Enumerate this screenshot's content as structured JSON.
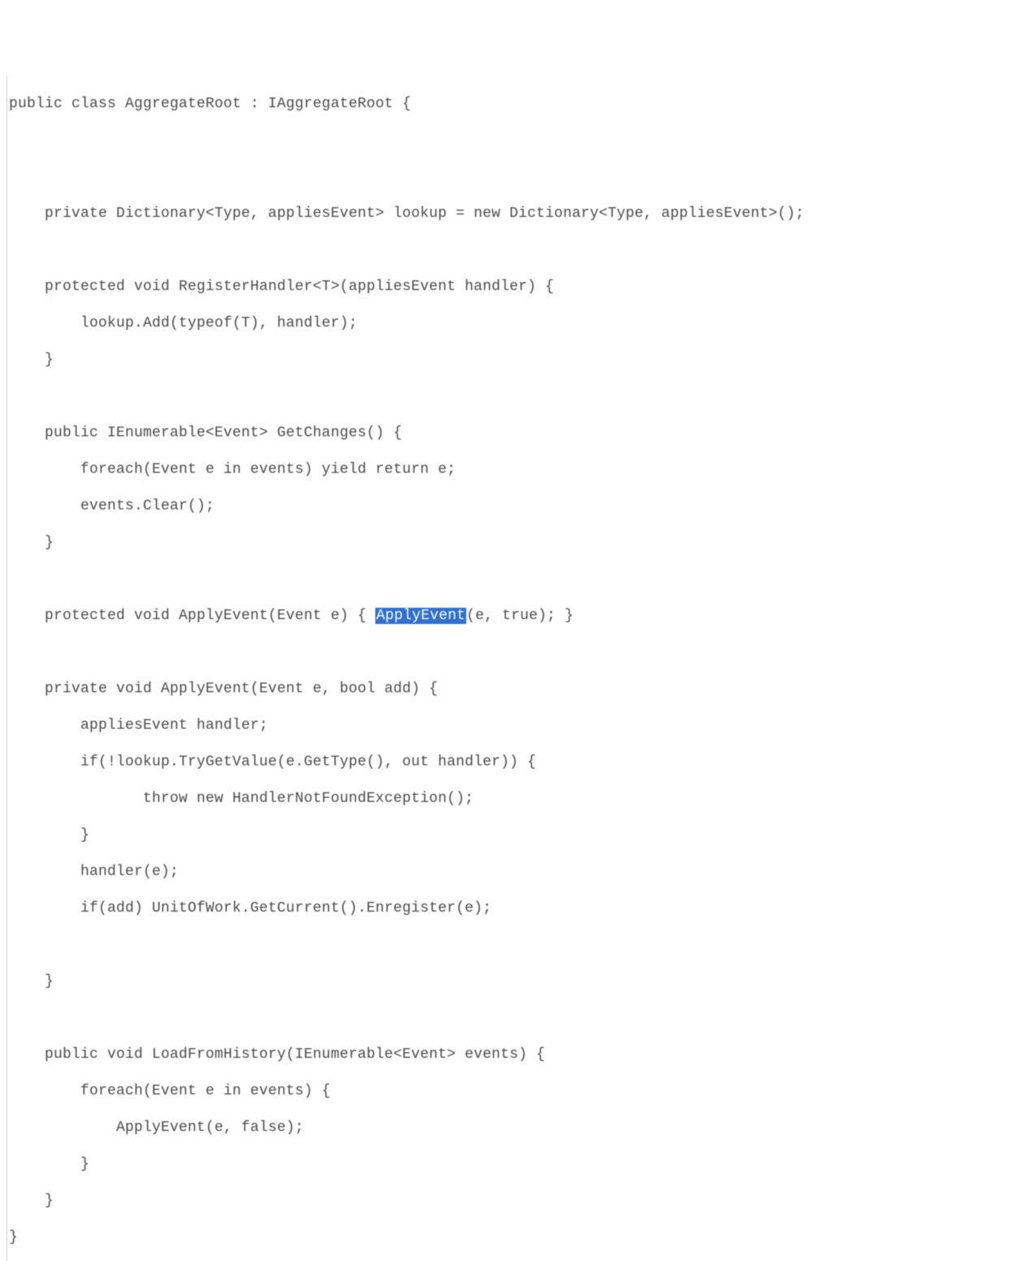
{
  "code": {
    "line1": "public class AggregateRoot : IAggregateRoot {",
    "line2": "",
    "line3": "",
    "line4": "    private Dictionary<Type, appliesEvent> lookup = new Dictionary<Type, appliesEvent>();",
    "line5": "",
    "line6": "    protected void RegisterHandler<T>(appliesEvent handler) {",
    "line7": "        lookup.Add(typeof(T), handler);",
    "line8": "    }",
    "line9": "",
    "line10": "    public IEnumerable<Event> GetChanges() {",
    "line11": "        foreach(Event e in events) yield return e;",
    "line12": "        events.Clear();",
    "line13": "    }",
    "line14": "",
    "line15a": "    protected void ApplyEvent(Event e) { ",
    "line15b": "ApplyEvent",
    "line15c": "(e, true); }",
    "line16": "",
    "line17": "    private void ApplyEvent(Event e, bool add) {",
    "line18": "        appliesEvent handler;",
    "line19": "        if(!lookup.TryGetValue(e.GetType(), out handler)) {",
    "line20": "               throw new HandlerNotFoundException();",
    "line21": "        }",
    "line22": "        handler(e);",
    "line23": "        if(add) UnitOfWork.GetCurrent().Enregister(e);",
    "line24": "",
    "line25": "    }",
    "line26": "",
    "line27": "    public void LoadFromHistory(IEnumerable<Event> events) {",
    "line28": "        foreach(Event e in events) {",
    "line29": "            ApplyEvent(e, false);",
    "line30": "        }",
    "line31": "    }",
    "line32": "}"
  }
}
